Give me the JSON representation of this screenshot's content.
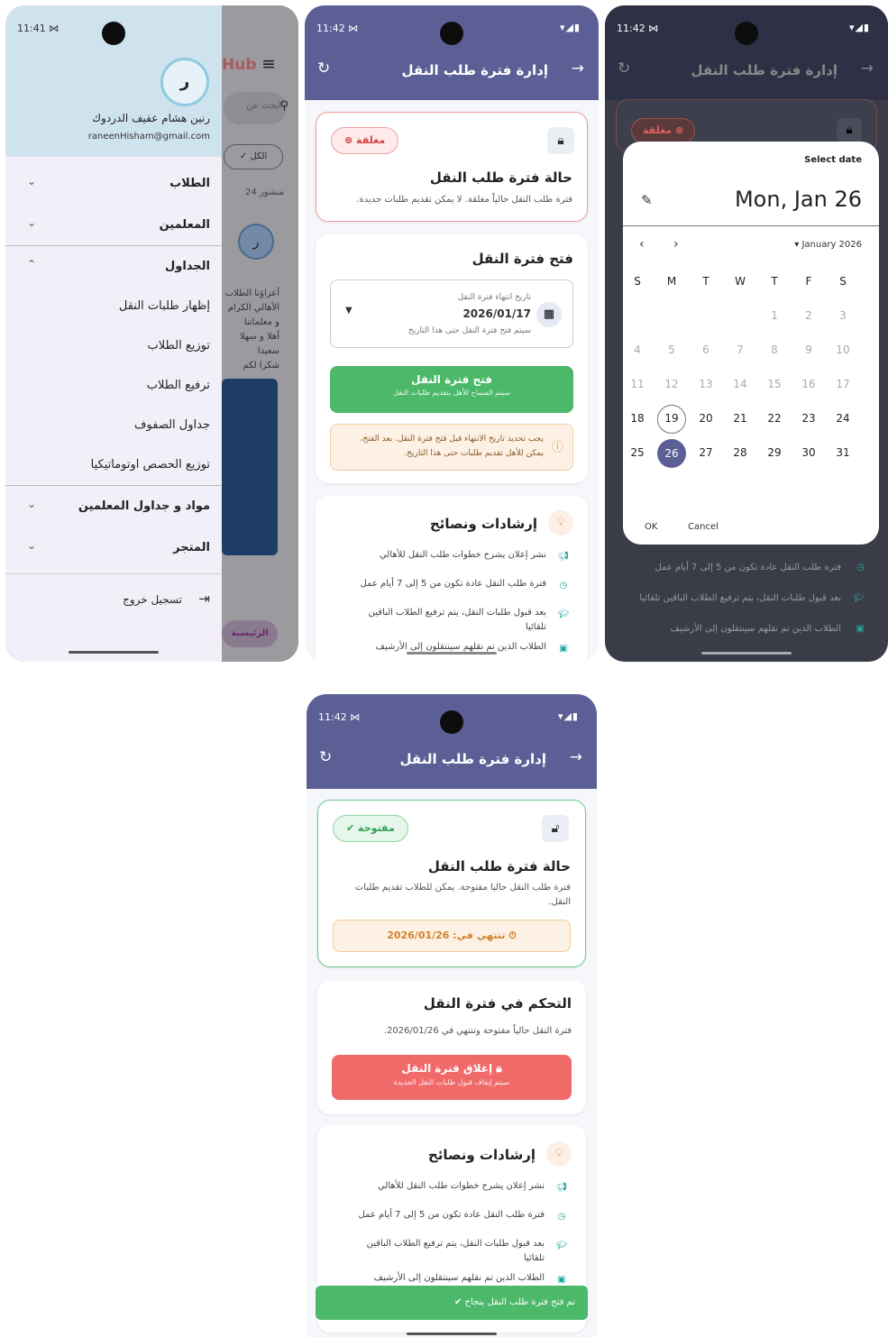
{
  "s1": {
    "time": "11:41 ⋈",
    "signal": "▾◢▮",
    "avatar_letter": "ر",
    "user_name": "رنين هشام عفيف الدردوك",
    "email": "raneenHisham@gmail.com",
    "bg": {
      "hub": "Hub",
      "search_placeholder": "ابحث عن",
      "all_chip": "الكل",
      "posts_count": "24 منشور",
      "post_title": "ر",
      "post_text": [
        "أعزاؤنا الطلاب",
        "الأهالي الكرام",
        "و معلماتنا",
        "أهلا و سهلا",
        "سعيدا",
        "شكرا لكم"
      ],
      "home_tab": "الرئيسية"
    },
    "menu": [
      {
        "label": "الطلاب",
        "bold": true,
        "chev": "⌄"
      },
      {
        "label": "المعلمين",
        "bold": true,
        "chev": "⌄"
      },
      {
        "label": "الجداول",
        "bold": true,
        "chev": "⌃"
      },
      {
        "label": "إظهار طلبات النقل"
      },
      {
        "label": "توزيع الطلاب"
      },
      {
        "label": "ترفيع الطلاب"
      },
      {
        "label": "جداول الصفوف"
      },
      {
        "label": "توزيع الحصص اوتوماتيكيا"
      },
      {
        "label": "مواد و جداول المعلمين",
        "bold": true,
        "chev": "⌄"
      },
      {
        "label": "المتجر",
        "bold": true,
        "chev": "⌄"
      }
    ],
    "logout": "تسجيل خروج"
  },
  "s2": {
    "time": "11:42 ⋈",
    "title": "إدارة فترة طلب النقل",
    "status": "مغلقة",
    "state_title": "حالة فترة طلب النقل",
    "state_desc": "فترة طلب النقل حالياً مغلقة. لا يمكن تقديم طلبات جديدة.",
    "open_title": "فتح فترة النقل",
    "date_label": "تاريخ انتهاء فترة النقل",
    "date_value": "2026/01/17",
    "date_hint": "سيتم فتح فترة النقل حتى هذا التاريخ",
    "open_btn": "فتح فترة النقل",
    "open_btn_sub": "سيتم السماح للأهل بتقديم طلبات النقل",
    "warn": "يجب تحديد تاريخ الانتهاء قبل فتح فترة النقل. بعد الفتح، يمكن للأهل تقديم طلبات حتى هذا التاريخ.",
    "tips_title": "إرشادات ونصائح",
    "tips": [
      "نشر إعلان يشرح خطوات طلب النقل للأهالي",
      "فترة طلب النقل عادة تكون من 5 إلى 7 أيام عمل",
      "بعد قبول طلبات النقل، يتم ترفيع الطلاب الباقين تلقائيا",
      "الطلاب الذين تم نقلهم سينتقلون إلى الأرشيف"
    ]
  },
  "s3": {
    "time": "11:42 ⋈",
    "title": "إدارة فترة طلب النقل",
    "status": "مغلقة",
    "select_date": "Select date",
    "headline": "Mon, Jan 26",
    "month": "January 2026",
    "weekdays": [
      "S",
      "F",
      "T",
      "W",
      "T",
      "M",
      "S"
    ],
    "weeks": [
      [
        "3",
        "2",
        "1",
        "",
        "",
        "",
        ""
      ],
      [
        "10",
        "9",
        "8",
        "7",
        "6",
        "5",
        "4"
      ],
      [
        "17",
        "16",
        "15",
        "14",
        "13",
        "12",
        "11"
      ],
      [
        "24",
        "23",
        "22",
        "21",
        "20",
        "19",
        "18"
      ],
      [
        "31",
        "30",
        "29",
        "28",
        "27",
        "26",
        "25"
      ]
    ],
    "today": "19",
    "selected": "26",
    "ok": "OK",
    "cancel": "Cancel",
    "bg_tips": [
      "فترة طلب النقل عادة تكون من 5 إلى 7 أيام عمل",
      "بعد قبول طلبات النقل، يتم ترفيع الطلاب الباقين تلقائيا",
      "الطلاب الذين تم نقلهم سينتقلون إلى الأرشيف"
    ]
  },
  "s4": {
    "time": "11:42 ⋈",
    "title": "إدارة فترة طلب النقل",
    "status": "مفتوحة",
    "state_title": "حالة فترة طلب النقل",
    "state_desc": "فترة طلب النقل حاليا مفتوحة. يمكن للطلاب تقديم طلبات النقل.",
    "ends": "تنتهي في: 2026/01/26",
    "control_title": "التحكم في فترة النقل",
    "control_desc": "فترة النقل حالياً مفتوحة وتنتهي في 2026/01/26.",
    "close_btn": "إغلاق فترة النقل",
    "close_btn_sub": "سيتم إيقاف قبول طلبات النقل الجديدة",
    "tips_title": "إرشادات ونصائح",
    "tips": [
      "نشر إعلان يشرح خطوات طلب النقل للأهالي",
      "فترة طلب النقل عادة تكون من 5 إلى 7 أيام عمل",
      "بعد قبول طلبات النقل، يتم ترفيع الطلاب الباقين تلقائيا",
      "الطلاب الذين تم نقلهم سينتقلون إلى الأرشيف"
    ],
    "toast": "تم فتح فترة طلب النقل بنجاح"
  },
  "colors": {
    "primary": "#5b5f95",
    "green": "#4cb86a",
    "red": "#f06a6a",
    "drawer_head": "#cfe3ee",
    "drawer_bg": "#f3eff8"
  }
}
